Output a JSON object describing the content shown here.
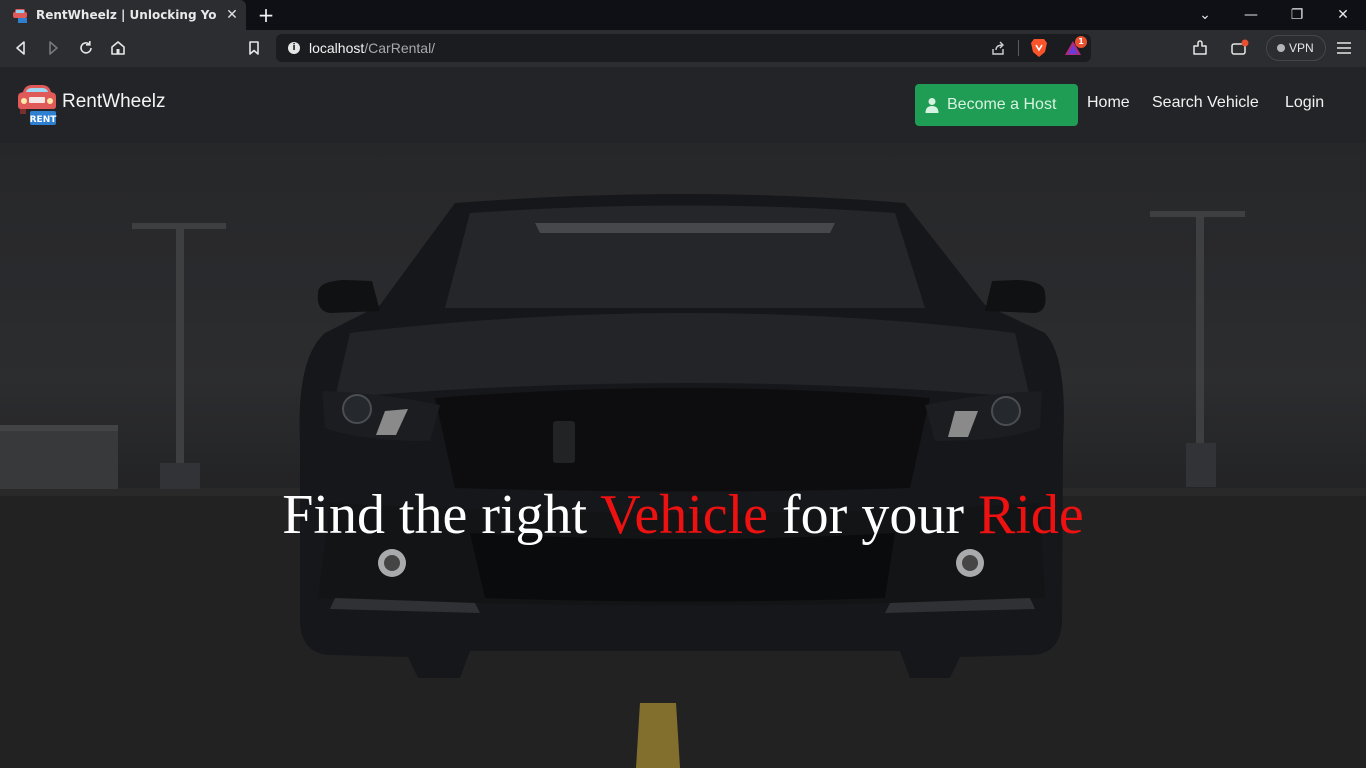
{
  "browser": {
    "tab_title": "RentWheelz | Unlocking Your Self",
    "tab_close": "✕",
    "new_tab": "+",
    "url_host": "localhost",
    "url_path": "/CarRental/",
    "vpn_label": "VPN",
    "notification_count": "1",
    "window_controls": {
      "collapse": "⌄",
      "minimize": "—",
      "restore": "❐",
      "close": "✕"
    }
  },
  "site": {
    "brand_name": "RentWheelz",
    "logo_badge": "RENT",
    "nav": {
      "host_button": "Become a Host",
      "home": "Home",
      "search": "Search Vehicle",
      "login": "Login"
    },
    "hero": {
      "headline_part1": "Find the right ",
      "headline_highlight1": "Vehicle",
      "headline_part2": " for your ",
      "headline_highlight2": "Ride"
    }
  },
  "colors": {
    "host_button": "#1f9d55",
    "highlight": "#e11111",
    "navbar": "#232428"
  }
}
